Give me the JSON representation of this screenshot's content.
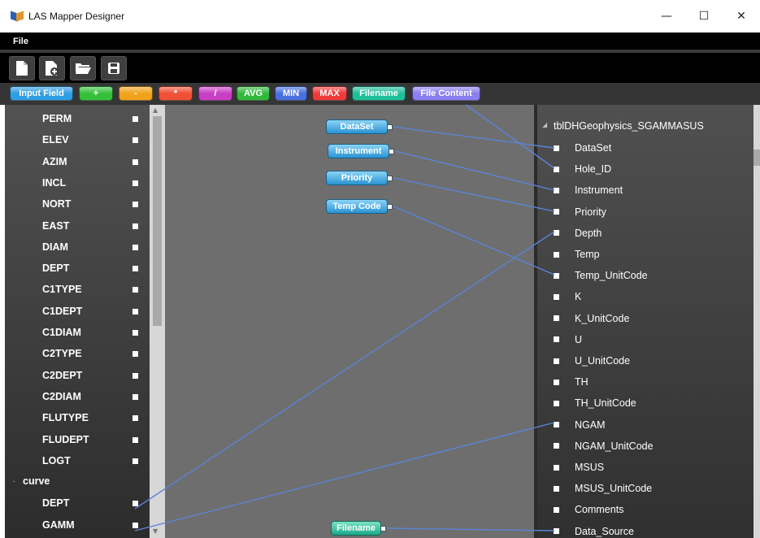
{
  "window": {
    "title": "LAS Mapper Designer",
    "minimize": "—",
    "maximize": "☐",
    "close": "✕"
  },
  "menu": {
    "file": "File"
  },
  "toolbar": {
    "icons": [
      "new-file-icon",
      "add-file-icon",
      "open-folder-icon",
      "save-icon"
    ]
  },
  "palette": [
    {
      "label": "Input Field",
      "color": "#2f9ee3"
    },
    {
      "label": "+",
      "color": "#35c03a"
    },
    {
      "label": "-",
      "color": "#f0a21a"
    },
    {
      "label": "*",
      "color": "#f05035"
    },
    {
      "label": "/",
      "color": "#c83fc4"
    },
    {
      "label": "AVG",
      "color": "#32b83a"
    },
    {
      "label": "MIN",
      "color": "#4a6fe0"
    },
    {
      "label": "MAX",
      "color": "#f03a3a"
    },
    {
      "label": "Filename",
      "color": "#1fbf9a"
    },
    {
      "label": "File Content",
      "color": "#8a7ef0"
    }
  ],
  "left_fields": {
    "items": [
      "PERM",
      "ELEV",
      "AZIM",
      "INCL",
      "NORT",
      "EAST",
      "DIAM",
      "DEPT",
      "C1TYPE",
      "C1DEPT",
      "C1DIAM",
      "C2TYPE",
      "C2DEPT",
      "C2DIAM",
      "FLUTYPE",
      "FLUDEPT",
      "LOGT"
    ],
    "group": "curve",
    "group_items": [
      "DEPT",
      "GAMM"
    ]
  },
  "nodes": {
    "dataset": "DataSet",
    "instrument": "Instrument",
    "priority": "Priority",
    "temp_code": "Temp Code",
    "filename": "Filename"
  },
  "right_table": {
    "name": "tblDHGeophysics_SGAMMASUS",
    "fields": [
      "DataSet",
      "Hole_ID",
      "Instrument",
      "Priority",
      "Depth",
      "Temp",
      "Temp_UnitCode",
      "K",
      "K_UnitCode",
      "U",
      "U_UnitCode",
      "TH",
      "TH_UnitCode",
      "NGAM",
      "NGAM_UnitCode",
      "MSUS",
      "MSUS_UnitCode",
      "Comments",
      "Data_Source"
    ]
  },
  "colors": {
    "link": "#5a84d6",
    "node_blue": "#2a93d2",
    "node_green": "#18a98a"
  }
}
